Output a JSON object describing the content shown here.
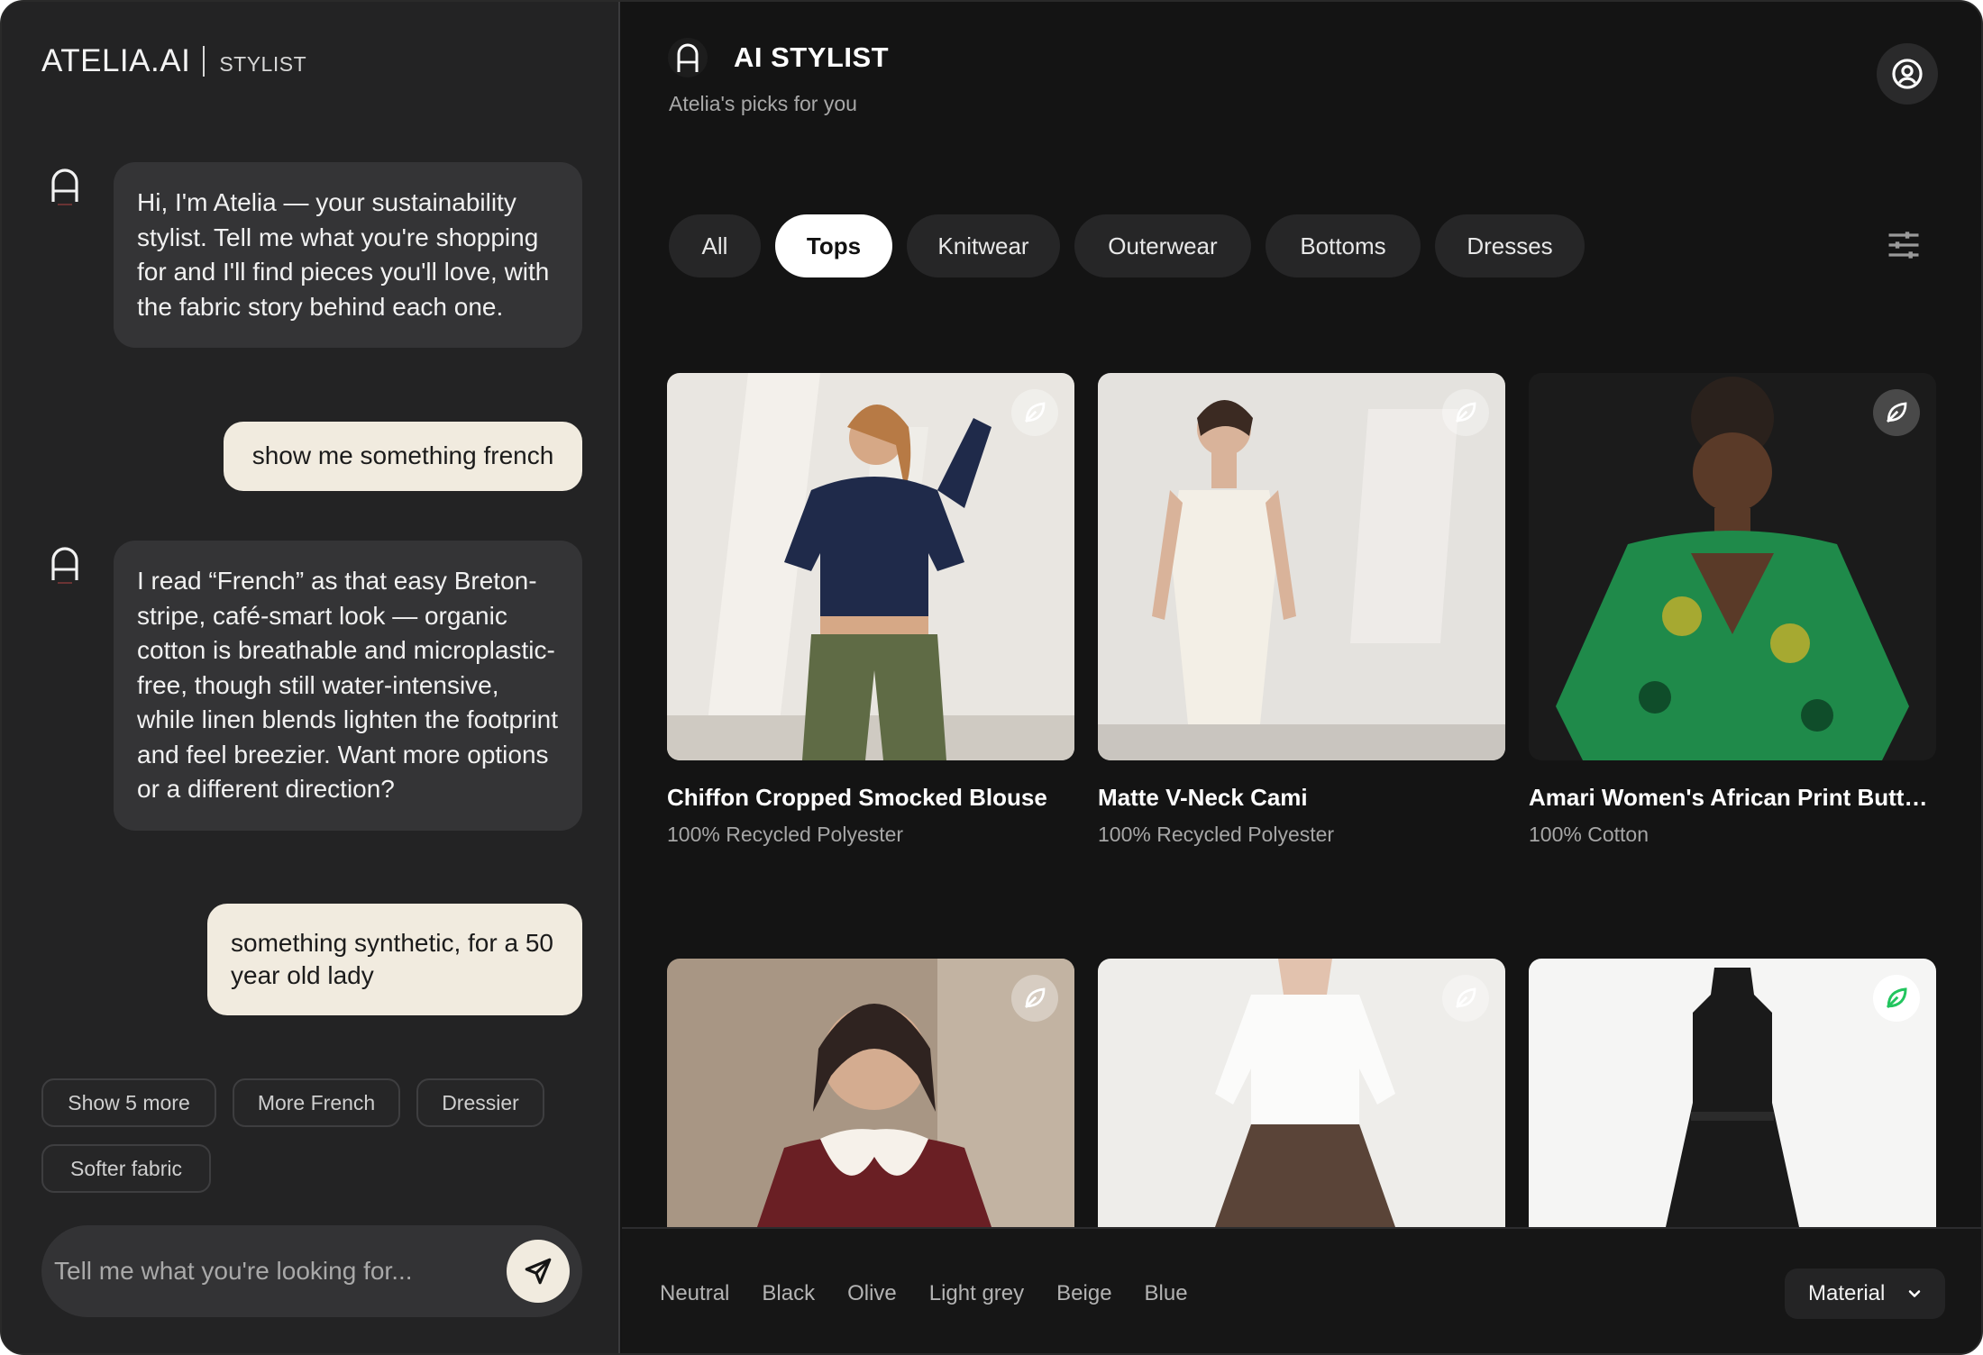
{
  "brand": {
    "name": "ATELIA.AI",
    "section": "STYLIST"
  },
  "chat": {
    "messages": [
      {
        "role": "assistant",
        "text": "Hi, I'm Atelia — your sustainability stylist. Tell me what you're shopping for and I'll find pieces you'll love, with the fabric story behind each one."
      },
      {
        "role": "user",
        "text": "show me something french"
      },
      {
        "role": "assistant",
        "text": "I read “French” as that easy Breton-stripe, café-smart look — organic cotton is breathable and microplastic-free, though still water-intensive, while linen blends lighten the footprint and feel breezier. Want more options or a different direction?"
      },
      {
        "role": "user",
        "text": "something synthetic, for a 50 year old lady"
      }
    ],
    "suggestions": [
      "Show 5 more",
      "More French",
      "Dressier",
      "Softer fabric"
    ],
    "input": {
      "placeholder": "Tell me what you're looking for...",
      "value": ""
    }
  },
  "main": {
    "title": "AI STYLIST",
    "subtitle": "Atelia's picks for you",
    "tabs": [
      {
        "label": "All",
        "active": false
      },
      {
        "label": "Tops",
        "active": true
      },
      {
        "label": "Knitwear",
        "active": false
      },
      {
        "label": "Outerwear",
        "active": false
      },
      {
        "label": "Bottoms",
        "active": false
      },
      {
        "label": "Dresses",
        "active": false
      }
    ],
    "products": [
      {
        "title": "Chiffon Cropped Smocked Blouse",
        "material": "100% Recycled Polyester",
        "badge": "leaf-icon"
      },
      {
        "title": "Matte V-Neck Cami",
        "material": "100% Recycled Polyester",
        "badge": "leaf-icon"
      },
      {
        "title": "Amari Women's African Print Button-Down Shirt",
        "material": "100% Cotton",
        "badge": "leaf-icon"
      },
      {
        "title": "",
        "material": "",
        "badge": "leaf-icon"
      },
      {
        "title": "",
        "material": "",
        "badge": "leaf-icon"
      },
      {
        "title": "",
        "material": "",
        "badge": "leaf-icon"
      }
    ],
    "colors": [
      "Neutral",
      "Black",
      "Olive",
      "Light grey",
      "Beige",
      "Blue"
    ],
    "sort": {
      "label": "Material"
    }
  },
  "theme": {
    "accent": "#f1ebdf",
    "background": "#141414",
    "panel": "#232324",
    "eco_green": "#22c55e"
  }
}
